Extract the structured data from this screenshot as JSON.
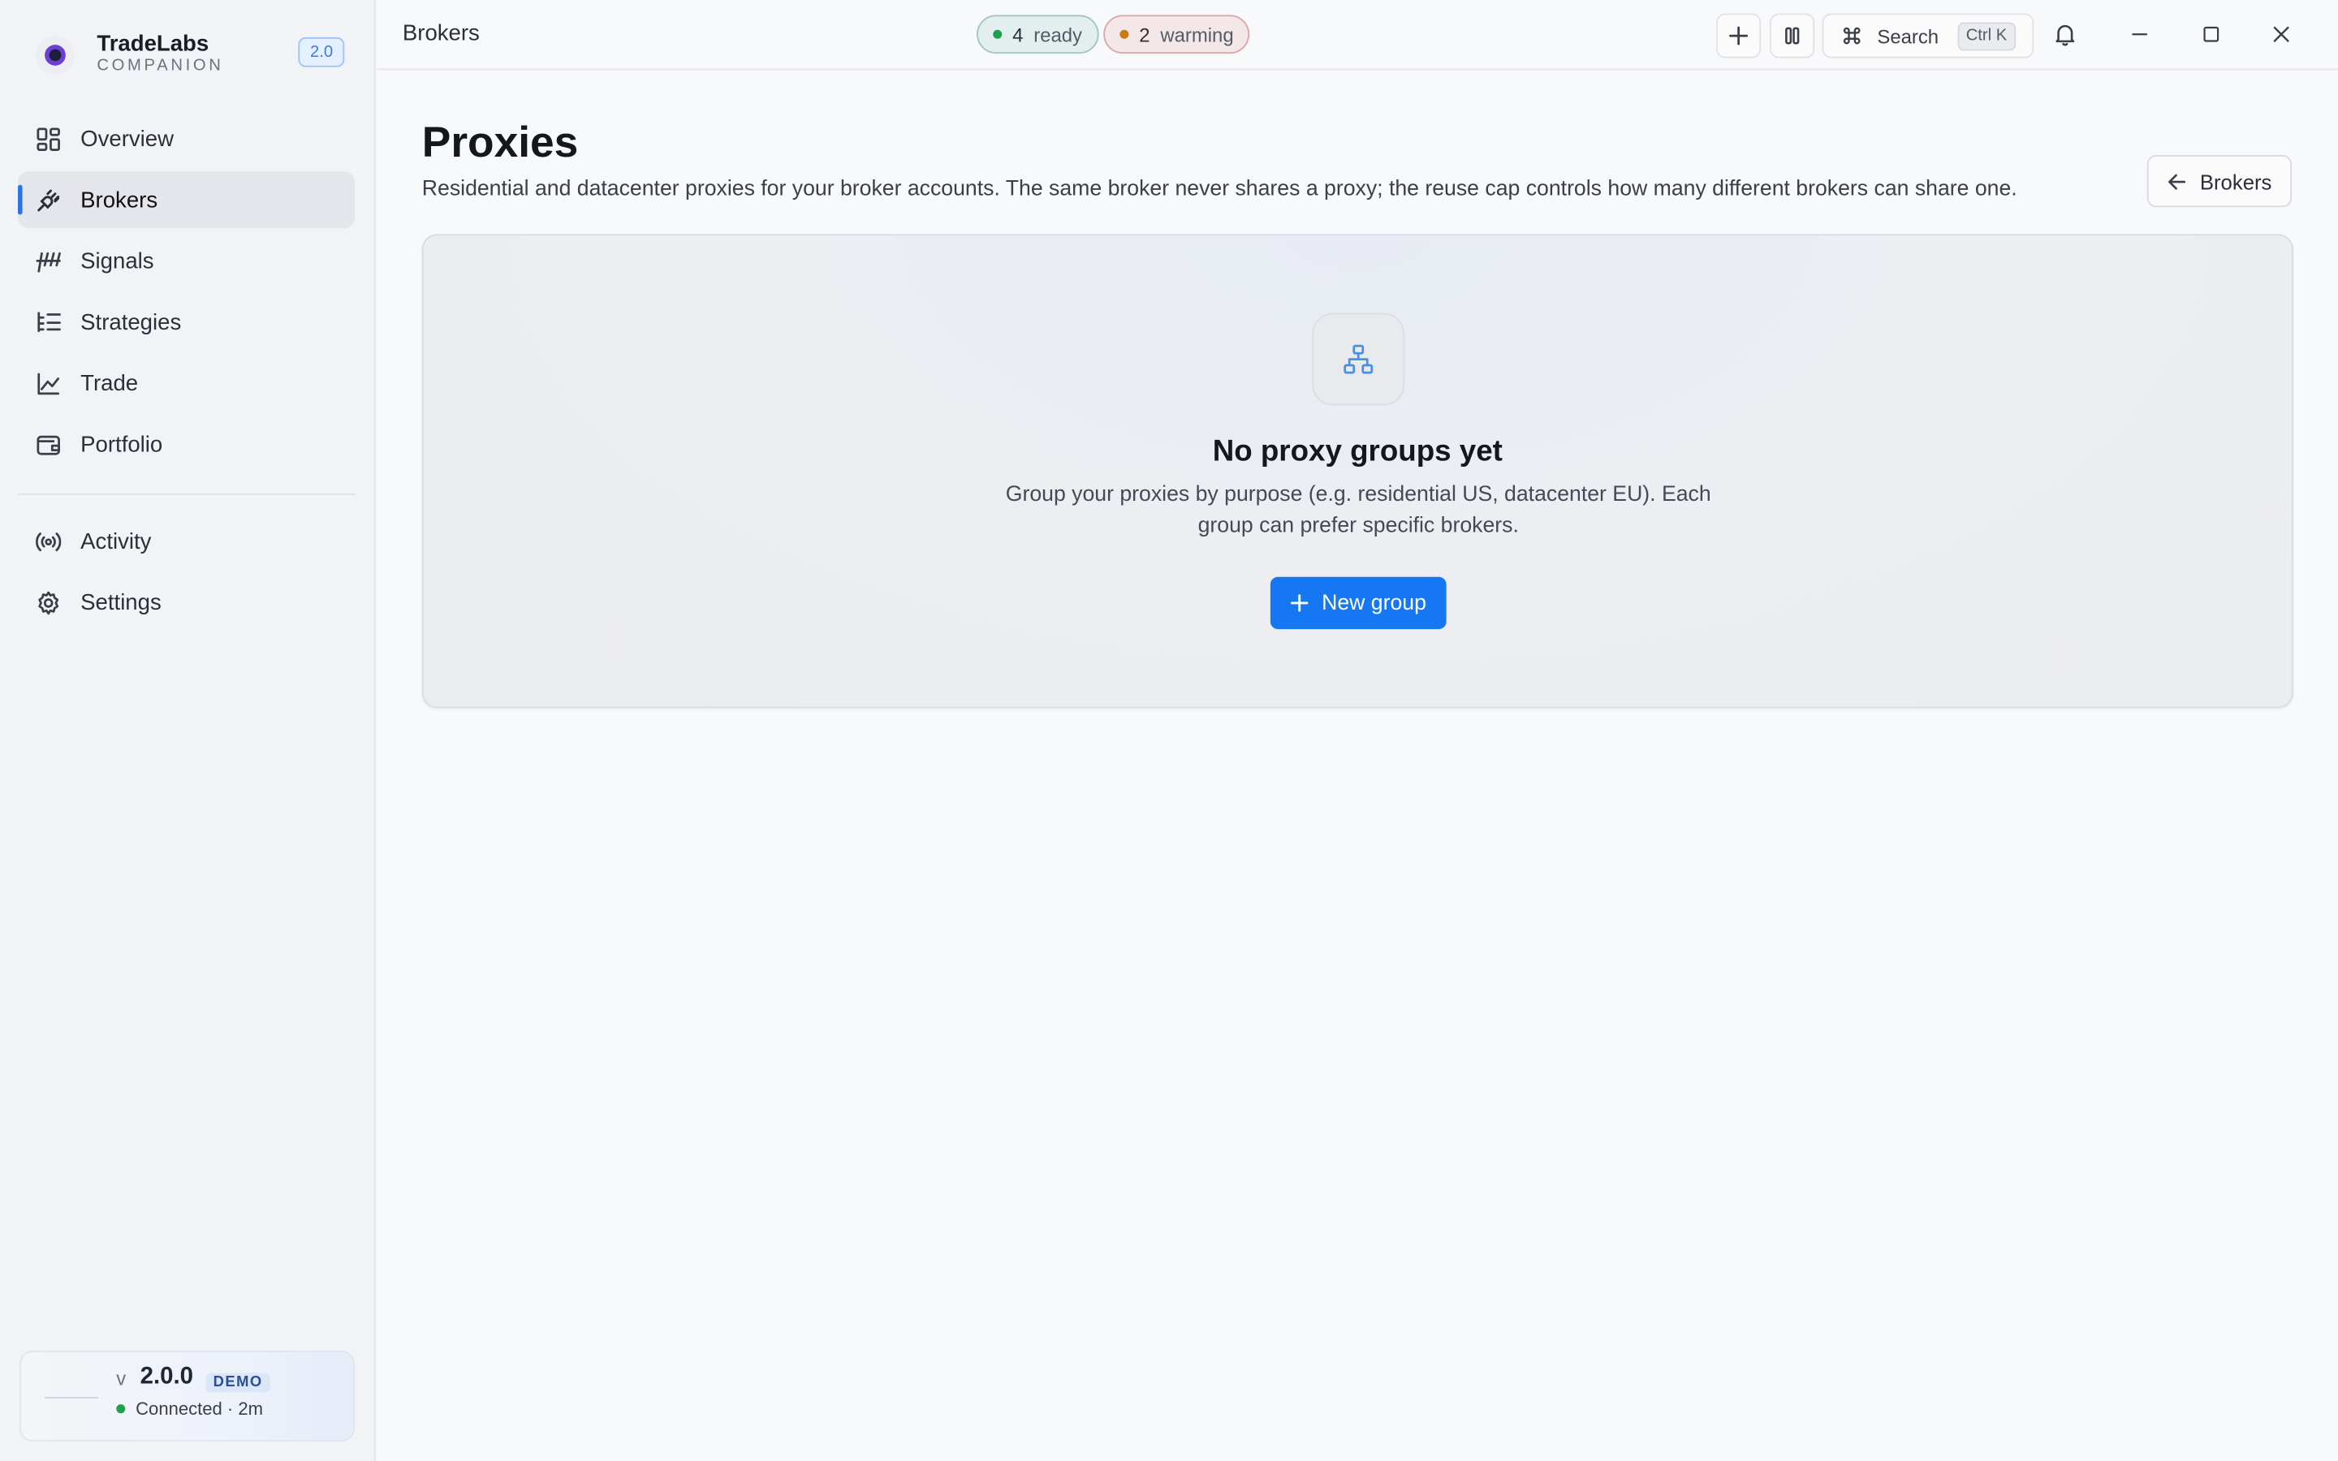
{
  "brand": {
    "name": "TradeLabs",
    "subtitle": "COMPANION",
    "version_badge": "2.0"
  },
  "sidebar": {
    "items": [
      {
        "label": "Overview",
        "icon": "grid-icon"
      },
      {
        "label": "Brokers",
        "icon": "plug-icon",
        "active": true
      },
      {
        "label": "Signals",
        "icon": "signals-icon"
      },
      {
        "label": "Strategies",
        "icon": "list-tree-icon"
      },
      {
        "label": "Trade",
        "icon": "chart-line-icon"
      },
      {
        "label": "Portfolio",
        "icon": "wallet-icon"
      }
    ],
    "secondary": [
      {
        "label": "Activity",
        "icon": "broadcast-icon"
      },
      {
        "label": "Settings",
        "icon": "gear-icon"
      }
    ],
    "status": {
      "v_prefix": "v",
      "version": "2.0.0",
      "badge": "DEMO",
      "connection": "Connected · 2m"
    }
  },
  "topbar": {
    "breadcrumb": "Brokers",
    "ready_count": "4",
    "ready_label": "ready",
    "warming_count": "2",
    "warming_label": "warming",
    "search_label": "Search",
    "search_shortcut": "Ctrl K"
  },
  "main": {
    "title": "Proxies",
    "description": "Residential and datacenter proxies for your broker accounts. The same broker never shares a proxy; the reuse cap controls how many different brokers can share one.",
    "back_button": "Brokers",
    "empty": {
      "title": "No proxy groups yet",
      "text": "Group your proxies by purpose (e.g. residential US, datacenter EU). Each group can prefer specific brokers.",
      "button": "New group"
    }
  },
  "colors": {
    "accent": "#1677f2",
    "ready": "#1fa14c",
    "warming": "#c97a12"
  }
}
